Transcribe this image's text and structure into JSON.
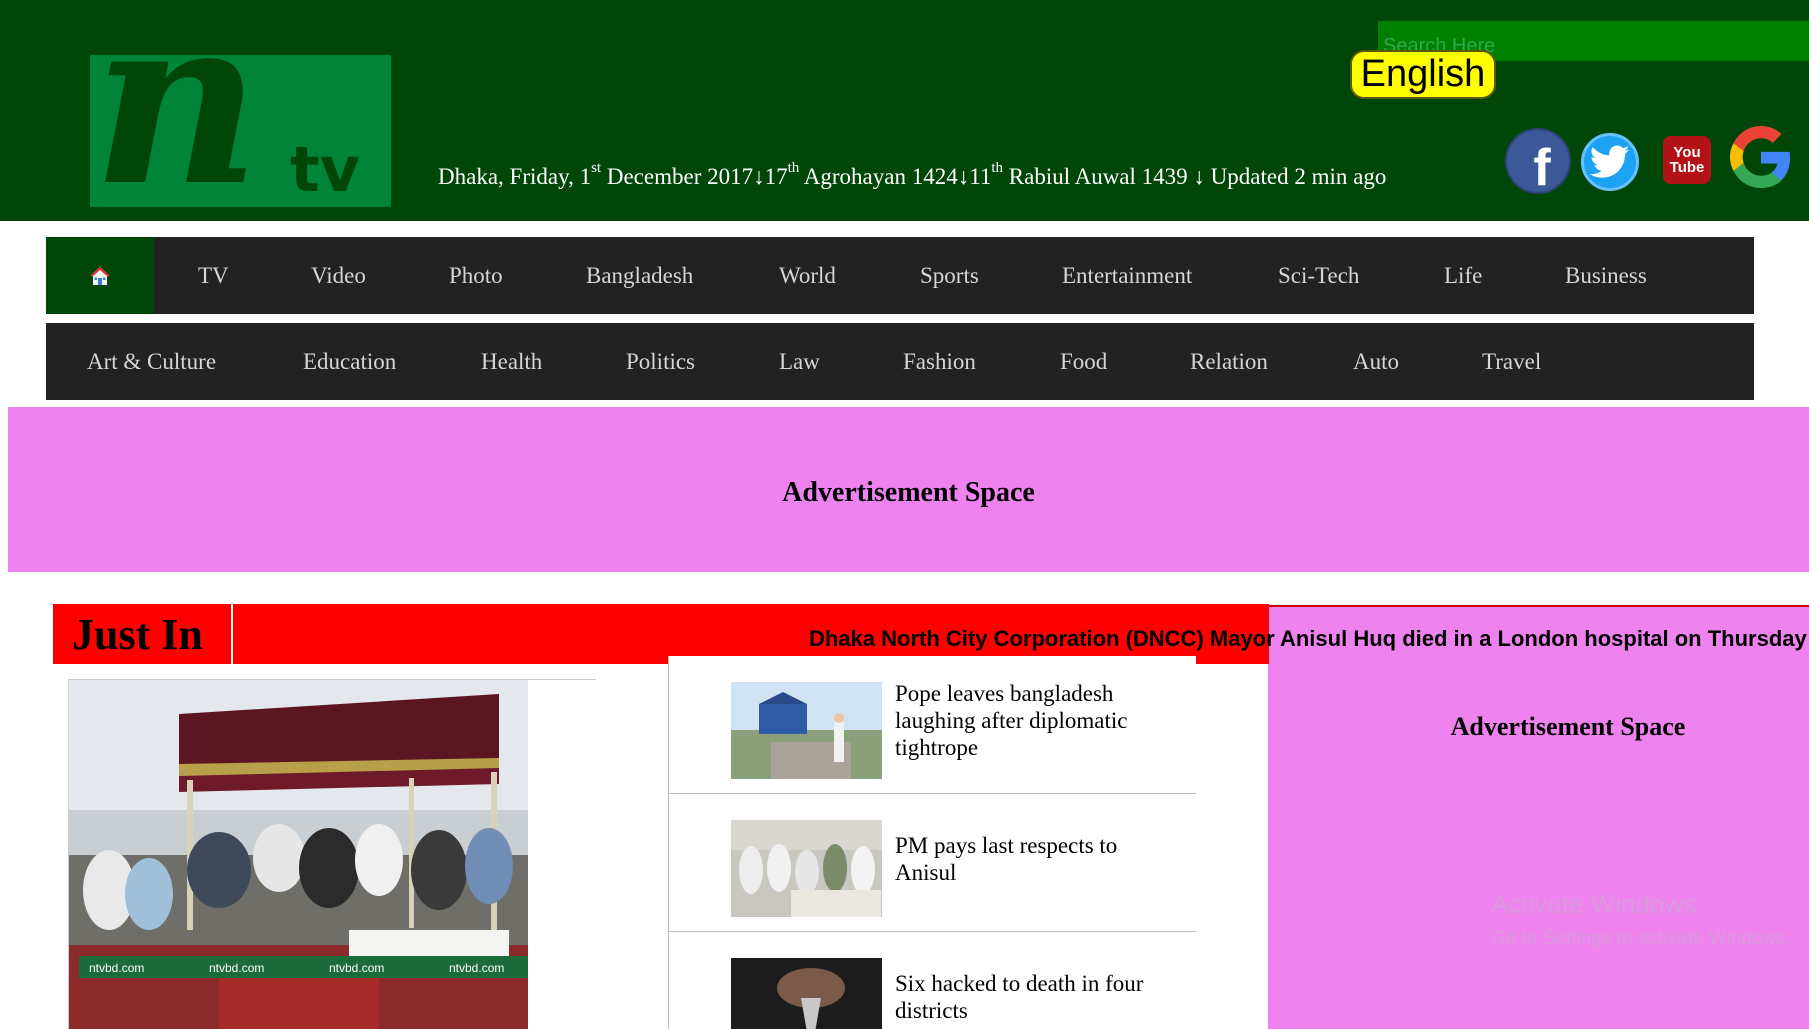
{
  "header": {
    "logo_n": "n",
    "logo_tv": "tv",
    "date": {
      "city_day": "Dhaka, Friday, 1",
      "sup1": "st",
      "part2": " December 2017↓17",
      "sup2": "th",
      "part3": " Agrohayan 1424↓11",
      "sup3": "th",
      "part4": " Rabiul Auwal 1439 ↓ Updated 2 min ago"
    },
    "search_placeholder": "Search Here",
    "language_button": "English",
    "social": {
      "facebook": "f",
      "youtube_top": "You",
      "youtube_bottom": "Tube"
    }
  },
  "nav_primary": [
    "TV",
    "Video",
    "Photo",
    "Bangladesh",
    "World",
    "Sports",
    "Entertainment",
    "Sci-Tech",
    "Life",
    "Business"
  ],
  "nav_secondary": [
    "Art & Culture",
    "Education",
    "Health",
    "Politics",
    "Law",
    "Fashion",
    "Food",
    "Relation",
    "Auto",
    "Travel"
  ],
  "ads": {
    "top": "Advertisement Space",
    "side": "Advertisement Space"
  },
  "just_in": {
    "label": "Just In",
    "ticker": "Dhaka North City Corporation (DNCC) Mayor Anisul Huq died in a London hospital on Thursday"
  },
  "lead_image": {
    "watermark": "ntvbd.com"
  },
  "news": [
    {
      "title": "Pope leaves bangladesh laughing after diplomatic tightrope"
    },
    {
      "title": "PM pays last respects to Anisul"
    },
    {
      "title": "Six hacked to death in four districts"
    }
  ],
  "system_overlay": {
    "line1": "Activate Windows",
    "line2": "Go to Settings to activate Windows."
  },
  "colors": {
    "header_bg": "#004609",
    "logo_bg": "#00843a",
    "nav_bg": "#222222",
    "ad_bg": "#ee82ee",
    "ticker_bg": "#ff0000",
    "language_button_bg": "#ffff00"
  }
}
